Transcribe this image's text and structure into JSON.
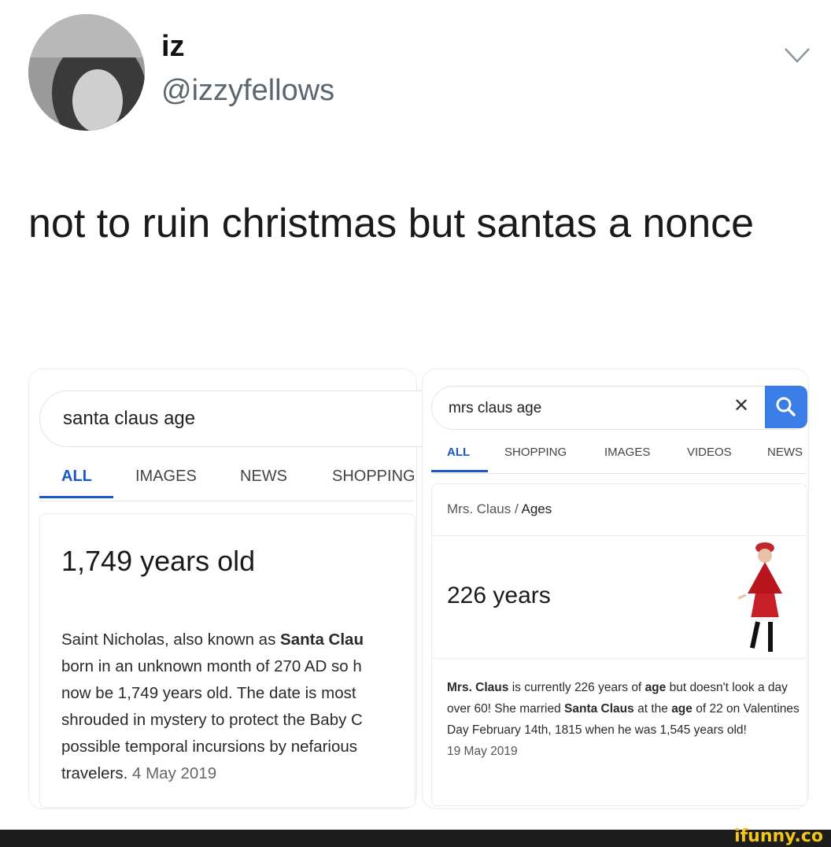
{
  "tweet": {
    "display_name": "iz",
    "handle": "@izzyfellows",
    "text": "not to ruin christmas but santas a nonce"
  },
  "left_screenshot": {
    "query": "santa claus age",
    "tabs": [
      "ALL",
      "IMAGES",
      "NEWS",
      "SHOPPING"
    ],
    "answer": "1,749 years old",
    "snippet_lines": [
      [
        "Saint Nicholas, also known as ",
        "Santa Clau"
      ],
      [
        "born in an unknown month of 270 AD so h",
        ""
      ],
      [
        "now be 1,749 years old. The date is most",
        ""
      ],
      [
        "shrouded in mystery to protect the Baby C",
        ""
      ],
      [
        "possible temporal incursions by nefarious",
        ""
      ],
      [
        "travelers. ",
        ""
      ]
    ],
    "date": "4 May 2019"
  },
  "right_screenshot": {
    "query": "mrs claus age",
    "clear_icon": "close-icon",
    "search_icon": "search-icon",
    "tabs": [
      "ALL",
      "SHOPPING",
      "IMAGES",
      "VIDEOS",
      "NEWS"
    ],
    "breadcrumb_1": "Mrs. Claus",
    "breadcrumb_sep": "/",
    "breadcrumb_2": "Ages",
    "answer": "226 years",
    "snippet": {
      "b1": "Mrs. Claus",
      "t1": " is currently 226 years of ",
      "b2": "age",
      "t2": " but doesn't look a day over 60! She married ",
      "b3": "Santa Claus",
      "t3": " at the ",
      "b4": "age",
      "t4": " of 22 on Valentines Day February 14th, 1815 when he was 1,545 years old!"
    },
    "date": "19 May 2019"
  },
  "watermark": "ifunny.co",
  "colors": {
    "accent_blue": "#1a57c9",
    "search_button": "#3b7de6",
    "watermark_yellow": "#f2c417"
  }
}
